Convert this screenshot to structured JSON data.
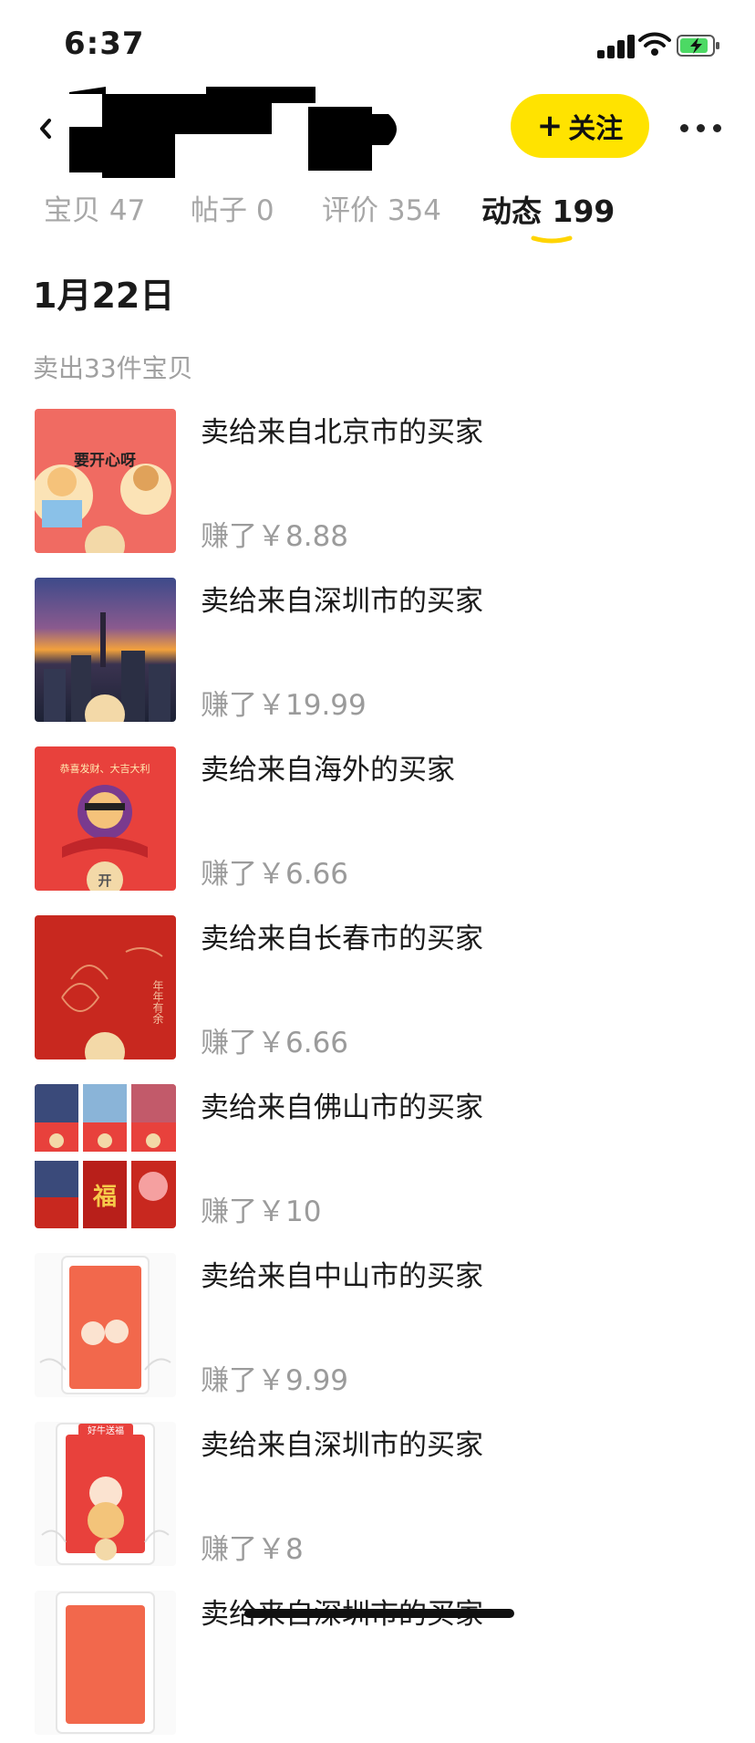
{
  "status_bar": {
    "time": "6:37"
  },
  "header": {
    "follow_label": "关注"
  },
  "tabs": [
    {
      "label": "宝贝 47"
    },
    {
      "label": "帖子 0"
    },
    {
      "label": "评价 354"
    },
    {
      "label": "动态 199",
      "active": true
    }
  ],
  "feed": {
    "date": "1月22日",
    "summary": "卖出33件宝贝",
    "items": [
      {
        "title": "卖给来自北京市的买家",
        "earned": "赚了￥8.88",
        "thumb_text": "要开心呀"
      },
      {
        "title": "卖给来自深圳市的买家",
        "earned": "赚了￥19.99"
      },
      {
        "title": "卖给来自海外的买家",
        "earned": "赚了￥6.66",
        "thumb_text": "恭喜发财、大吉大利",
        "thumb_badge": "开"
      },
      {
        "title": "卖给来自长春市的买家",
        "earned": "赚了￥6.66",
        "thumb_text": "年年有余"
      },
      {
        "title": "卖给来自佛山市的买家",
        "earned": "赚了￥10",
        "thumb_text": "福"
      },
      {
        "title": "卖给来自中山市的买家",
        "earned": "赚了￥9.99"
      },
      {
        "title": "卖给来自深圳市的买家",
        "earned": "赚了￥8",
        "thumb_text": "好牛送福"
      },
      {
        "title": "卖给来自深圳市的买家",
        "earned": ""
      }
    ]
  },
  "colors": {
    "accent": "#ffe300",
    "red_envelope": "#e8413c",
    "muted_text": "#a0a0a0"
  }
}
